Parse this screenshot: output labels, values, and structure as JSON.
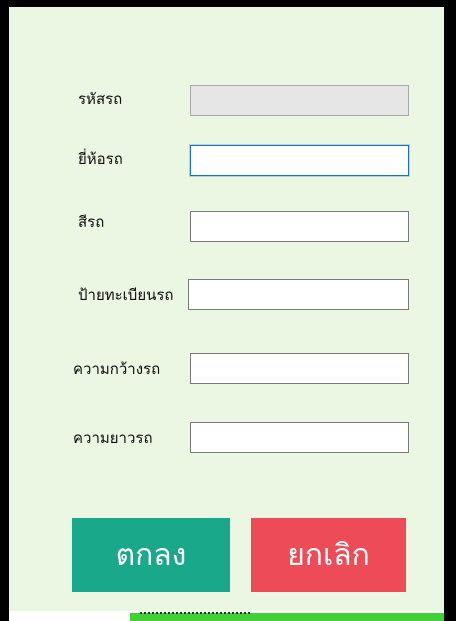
{
  "colors": {
    "panel_background": "#ebf6e3",
    "ok_button": "#1aa88a",
    "cancel_button": "#ee4b58",
    "focus_border": "#1f6fc5",
    "readonly_field": "#e6e6e6"
  },
  "form": {
    "fields": [
      {
        "label": "รหัสรถ",
        "value": "",
        "state": "readonly"
      },
      {
        "label": "ยี่ห้อรถ",
        "value": "",
        "state": "focused"
      },
      {
        "label": "สีรถ",
        "value": "",
        "state": "normal"
      },
      {
        "label": "ป้ายทะเบียนรถ",
        "value": "",
        "state": "normal"
      },
      {
        "label": "ความกว้างรถ",
        "value": "",
        "state": "normal"
      },
      {
        "label": "ความยาวรถ",
        "value": "",
        "state": "normal"
      }
    ],
    "ok_label": "ตกลง",
    "cancel_label": "ยกเลิก"
  }
}
